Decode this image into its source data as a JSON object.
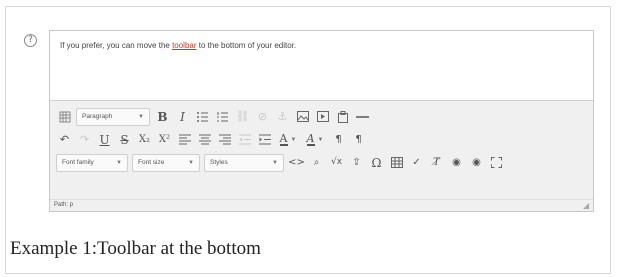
{
  "help_icon": "?",
  "content": {
    "text_before": "If you prefer, you can move the ",
    "underlined_word": "toolbar",
    "text_after": " to the bottom of your editor."
  },
  "toolbar": {
    "row1": {
      "paragraph_dropdown": "Paragraph",
      "bold": "B",
      "italic": "I"
    },
    "row2": {
      "underline": "U",
      "strike": "S",
      "subscript": "X₂",
      "superscript": "X²",
      "font_color": "A",
      "highlight": "A"
    },
    "row3": {
      "font_family_dropdown": "Font family",
      "font_size_dropdown": "Font size",
      "styles_dropdown": "Styles",
      "omega": "Ω"
    }
  },
  "status": {
    "path": "Path: p"
  },
  "caption": "Example 1:Toolbar at the bottom",
  "colors": {
    "underline_accent": "#c0392b",
    "toolbar_bg": "#f0f0f0",
    "border": "#c8c8c8"
  }
}
